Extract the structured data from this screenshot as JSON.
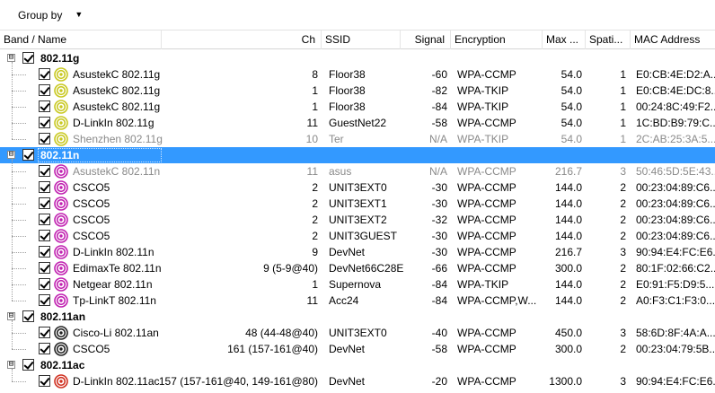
{
  "toolbar": {
    "groupby_label": "Group by",
    "caret": "▼"
  },
  "columns": {
    "band_name": "Band / Name",
    "ch": "Ch",
    "ssid": "SSID",
    "signal": "Signal",
    "encryption": "Encryption",
    "max": "Max ...",
    "spatial": "Spati...",
    "mac": "MAC Address"
  },
  "colors": {
    "selected": "#3399ff",
    "g_icon": "#c8c820",
    "n_icon": "#c020b0",
    "an_icon": "#222222",
    "ac_icon": "#d03020"
  },
  "rows": [
    {
      "type": "group",
      "expander": "⊟",
      "name": "802.11g"
    },
    {
      "type": "item",
      "icon": "g",
      "name": "AsustekC 802.11g",
      "ch": "8",
      "ssid": "Floor38",
      "signal": "-60",
      "enc": "WPA-CCMP",
      "max": "54.0",
      "spatial": "1",
      "mac": "E0:CB:4E:D2:A..."
    },
    {
      "type": "item",
      "icon": "g",
      "name": "AsustekC 802.11g",
      "ch": "1",
      "ssid": "Floor38",
      "signal": "-82",
      "enc": "WPA-TKIP",
      "max": "54.0",
      "spatial": "1",
      "mac": "E0:CB:4E:DC:8..."
    },
    {
      "type": "item",
      "icon": "g",
      "name": "AsustekC 802.11g",
      "ch": "1",
      "ssid": "Floor38",
      "signal": "-84",
      "enc": "WPA-TKIP",
      "max": "54.0",
      "spatial": "1",
      "mac": "00:24:8C:49:F2..."
    },
    {
      "type": "item",
      "icon": "g",
      "name": "D-LinkIn 802.11g",
      "ch": "11",
      "ssid": "GuestNet22",
      "signal": "-58",
      "enc": "WPA-CCMP",
      "max": "54.0",
      "spatial": "1",
      "mac": "1C:BD:B9:79:C..."
    },
    {
      "type": "item",
      "icon": "g",
      "dim": true,
      "name": "Shenzhen 802.11g",
      "ch": "10",
      "ssid": "Ter",
      "signal": "N/A",
      "enc": "WPA-TKIP",
      "max": "54.0",
      "spatial": "1",
      "mac": "2C:AB:25:3A:5..."
    },
    {
      "type": "group",
      "expander": "⊟",
      "name": "802.11n",
      "selected": true
    },
    {
      "type": "item",
      "icon": "n",
      "dim": true,
      "name": "AsustekC 802.11n",
      "ch": "11",
      "ssid": "asus",
      "signal": "N/A",
      "enc": "WPA-CCMP",
      "max": "216.7",
      "spatial": "3",
      "mac": "50:46:5D:5E:43..."
    },
    {
      "type": "item",
      "icon": "n",
      "name": "CSCO5",
      "ch": "2",
      "ssid": "UNIT3EXT0",
      "signal": "-30",
      "enc": "WPA-CCMP",
      "max": "144.0",
      "spatial": "2",
      "mac": "00:23:04:89:C6..."
    },
    {
      "type": "item",
      "icon": "n",
      "name": "CSCO5",
      "ch": "2",
      "ssid": "UNIT3EXT1",
      "signal": "-30",
      "enc": "WPA-CCMP",
      "max": "144.0",
      "spatial": "2",
      "mac": "00:23:04:89:C6..."
    },
    {
      "type": "item",
      "icon": "n",
      "name": "CSCO5",
      "ch": "2",
      "ssid": "UNIT3EXT2",
      "signal": "-32",
      "enc": "WPA-CCMP",
      "max": "144.0",
      "spatial": "2",
      "mac": "00:23:04:89:C6..."
    },
    {
      "type": "item",
      "icon": "n",
      "name": "CSCO5",
      "ch": "2",
      "ssid": "UNIT3GUEST",
      "signal": "-30",
      "enc": "WPA-CCMP",
      "max": "144.0",
      "spatial": "2",
      "mac": "00:23:04:89:C6..."
    },
    {
      "type": "item",
      "icon": "n",
      "name": "D-LinkIn 802.11n",
      "ch": "9",
      "ssid": "DevNet",
      "signal": "-30",
      "enc": "WPA-CCMP",
      "max": "216.7",
      "spatial": "3",
      "mac": "90:94:E4:FC:E6..."
    },
    {
      "type": "item",
      "icon": "n",
      "name": "EdimaxTe 802.11n",
      "ch": "9 (5-9@40)",
      "ssid": "DevNet66C28E",
      "signal": "-66",
      "enc": "WPA-CCMP",
      "max": "300.0",
      "spatial": "2",
      "mac": "80:1F:02:66:C2..."
    },
    {
      "type": "item",
      "icon": "n",
      "name": "Netgear 802.11n",
      "ch": "1",
      "ssid": "Supernova",
      "signal": "-84",
      "enc": "WPA-TKIP",
      "max": "144.0",
      "spatial": "2",
      "mac": "E0:91:F5:D9:5..."
    },
    {
      "type": "item",
      "icon": "n",
      "name": "Tp-LinkT 802.11n",
      "ch": "11",
      "ssid": "Acc24",
      "signal": "-84",
      "enc": "WPA-CCMP,W...",
      "max": "144.0",
      "spatial": "2",
      "mac": "A0:F3:C1:F3:0..."
    },
    {
      "type": "group",
      "expander": "⊟",
      "name": "802.11an"
    },
    {
      "type": "item",
      "icon": "an",
      "name": "Cisco-Li 802.11an",
      "ch": "48 (44-48@40)",
      "ssid": "UNIT3EXT0",
      "signal": "-40",
      "enc": "WPA-CCMP",
      "max": "450.0",
      "spatial": "3",
      "mac": "58:6D:8F:4A:A..."
    },
    {
      "type": "item",
      "icon": "an",
      "name": "CSCO5",
      "ch": "161 (157-161@40)",
      "ssid": "DevNet",
      "signal": "-58",
      "enc": "WPA-CCMP",
      "max": "300.0",
      "spatial": "2",
      "mac": "00:23:04:79:5B..."
    },
    {
      "type": "group",
      "expander": "⊟",
      "name": "802.11ac"
    },
    {
      "type": "item",
      "icon": "ac",
      "name": "D-LinkIn 802.11ac",
      "ch": "157 (157-161@40, 149-161@80)",
      "ssid": "DevNet",
      "signal": "-20",
      "enc": "WPA-CCMP",
      "max": "1300.0",
      "spatial": "3",
      "mac": "90:94:E4:FC:E6..."
    }
  ]
}
